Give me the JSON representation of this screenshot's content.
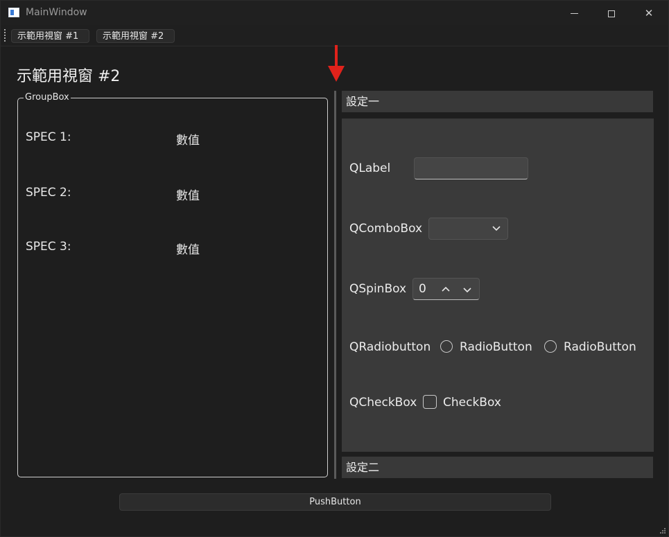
{
  "window": {
    "title": "MainWindow"
  },
  "toolbar": {
    "items": [
      {
        "label": "示範用視窗 #1"
      },
      {
        "label": "示範用視窗 #2"
      }
    ]
  },
  "page": {
    "title": "示範用視窗 #2"
  },
  "groupbox": {
    "title": "GroupBox",
    "specs": [
      {
        "label": "SPEC 1:",
        "value": "數值"
      },
      {
        "label": "SPEC 2:",
        "value": "數值"
      },
      {
        "label": "SPEC 3:",
        "value": "數值"
      }
    ]
  },
  "settings": {
    "section1": "設定一",
    "section2": "設定二",
    "qlabel": {
      "label": "QLabel",
      "value": ""
    },
    "combobox": {
      "label": "QComboBox",
      "selected": ""
    },
    "spinbox": {
      "label": "QSpinBox",
      "value": "0"
    },
    "radio": {
      "label": "QRadiobutton",
      "options": [
        "RadioButton",
        "RadioButton"
      ]
    },
    "checkbox": {
      "label": "QCheckBox",
      "text": "CheckBox"
    }
  },
  "push_button": {
    "label": "PushButton"
  },
  "colors": {
    "annotation_arrow": "#e0221b",
    "window_bg": "#1e1e1e",
    "panel_bg": "#3a3a3a"
  }
}
